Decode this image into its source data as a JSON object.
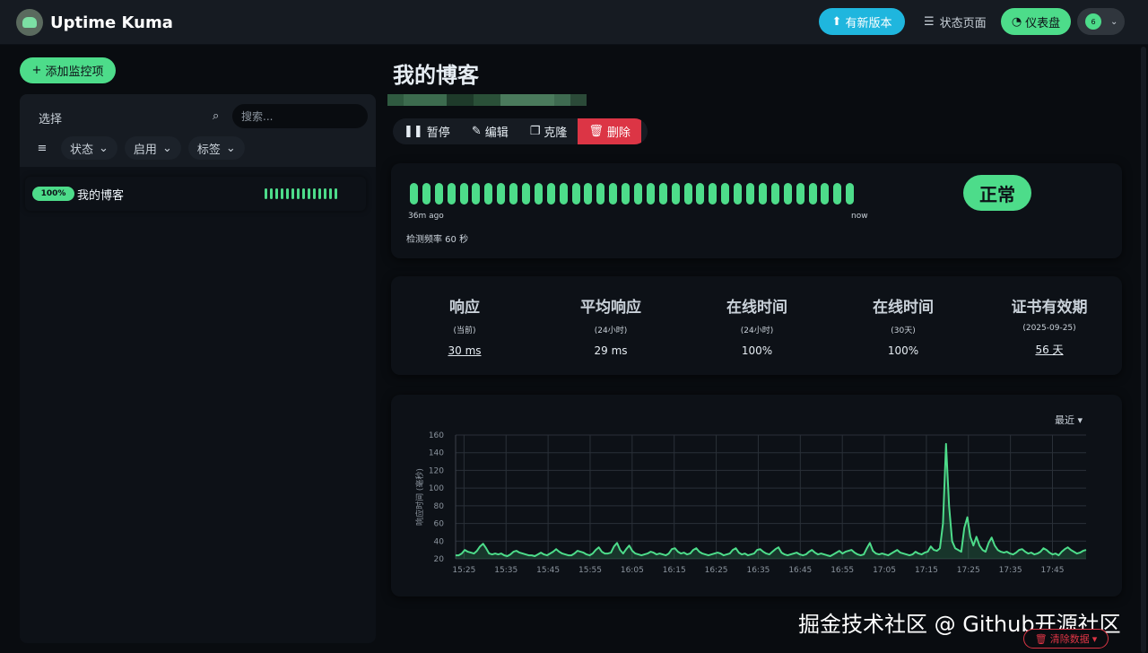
{
  "header": {
    "app_title": "Uptime Kuma",
    "update_label": "有新版本",
    "status_page_label": "状态页面",
    "dashboard_label": "仪表盘",
    "avatar_text": "6"
  },
  "sidebar": {
    "add_label": "添加监控项",
    "select_label": "选择",
    "search_placeholder": "搜索...",
    "filters": [
      "状态",
      "启用",
      "标签"
    ],
    "monitors": [
      {
        "uptime": "100%",
        "name": "我的博客"
      }
    ]
  },
  "detail": {
    "title": "我的博客",
    "actions": {
      "pause": "暂停",
      "edit": "编辑",
      "clone": "克隆",
      "delete": "删除"
    },
    "heartbeat": {
      "time_start": "36m ago",
      "time_end": "now",
      "interval": "检测频率 60 秒",
      "status": "正常",
      "beat_count": 36
    },
    "stats": [
      {
        "title": "响应",
        "sub": "(当前)",
        "value": "30 ms"
      },
      {
        "title": "平均响应",
        "sub": "(24小时)",
        "value": "29 ms"
      },
      {
        "title": "在线时间",
        "sub": "(24小时)",
        "value": "100%"
      },
      {
        "title": "在线时间",
        "sub": "(30天)",
        "value": "100%"
      },
      {
        "title": "证书有效期",
        "sub": "(2025-09-25)",
        "value": "56 天"
      }
    ],
    "chart_range_label": "最近",
    "clear_label": "清除数据"
  },
  "watermark": "掘金技术社区 @ Github开源社区",
  "colors": {
    "accent_green": "#4ddc8a",
    "info_blue": "#1fb6de",
    "danger_red": "#dc3545"
  },
  "chart_data": {
    "type": "area",
    "title": "",
    "ylabel": "响应时间 (毫秒)",
    "xlabel": "",
    "ylim": [
      20,
      160
    ],
    "yticks": [
      20,
      40,
      60,
      80,
      100,
      120,
      140,
      160
    ],
    "xticks": [
      "15:25",
      "15:35",
      "15:45",
      "15:55",
      "16:05",
      "16:15",
      "16:25",
      "16:35",
      "16:45",
      "16:55",
      "17:05",
      "17:15",
      "17:25",
      "17:35",
      "17:45"
    ],
    "x_start": "15:23",
    "x_end": "17:53",
    "grid": true,
    "series": [
      {
        "values": [
          24,
          24,
          26,
          30,
          28,
          27,
          26,
          29,
          34,
          37,
          32,
          26,
          25,
          26,
          25,
          26,
          24,
          23,
          25,
          28,
          29,
          27,
          26,
          25,
          24,
          24,
          23,
          25,
          27,
          25,
          24,
          26,
          28,
          31,
          28,
          26,
          25,
          24,
          24,
          26,
          29,
          28,
          27,
          25,
          24,
          26,
          30,
          33,
          28,
          26,
          26,
          27,
          34,
          38,
          30,
          26,
          31,
          35,
          29,
          26,
          25,
          24,
          25,
          26,
          28,
          27,
          25,
          26,
          25,
          24,
          26,
          31,
          32,
          28,
          26,
          27,
          25,
          26,
          30,
          32,
          28,
          26,
          25,
          24,
          25,
          26,
          27,
          26,
          24,
          25,
          26,
          30,
          32,
          27,
          25,
          26,
          24,
          25,
          26,
          30,
          31,
          28,
          26,
          25,
          28,
          31,
          33,
          27,
          25,
          24,
          25,
          26,
          27,
          25,
          24,
          25,
          28,
          30,
          27,
          25,
          26,
          25,
          24,
          23,
          25,
          27,
          29,
          26,
          28,
          29,
          30,
          27,
          25,
          24,
          25,
          32,
          38,
          29,
          26,
          25,
          26,
          25,
          24,
          26,
          28,
          30,
          27,
          26,
          25,
          24,
          25,
          28,
          26,
          25,
          27,
          28,
          34,
          30,
          29,
          32,
          60,
          150,
          80,
          40,
          32,
          30,
          28,
          55,
          67,
          45,
          35,
          45,
          35,
          30,
          28,
          38,
          44,
          35,
          30,
          28,
          27,
          28,
          26,
          25,
          27,
          30,
          31,
          28,
          26,
          27,
          25,
          26,
          28,
          32,
          30,
          27,
          25,
          26,
          24,
          28,
          31,
          33,
          30,
          28,
          26,
          27,
          29,
          30
        ]
      }
    ]
  }
}
